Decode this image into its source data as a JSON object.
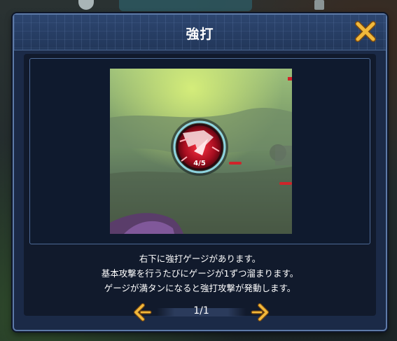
{
  "dialog": {
    "title": "強打",
    "description_lines": [
      "右下に強打ゲージがあります。",
      "基本攻撃を行うたびにゲージが1ずつ溜まります。",
      "ゲージが満タンになると強打攻撃が発動します。"
    ]
  },
  "preview": {
    "gauge_label": "4/5",
    "gauge_value": 4,
    "gauge_max": 5
  },
  "pager": {
    "text": "1/1"
  },
  "colors": {
    "accent_gold": "#f2b93b",
    "panel": "#1b2a47",
    "border": "#5d7aa8",
    "gauge_red": "#c8102e"
  }
}
